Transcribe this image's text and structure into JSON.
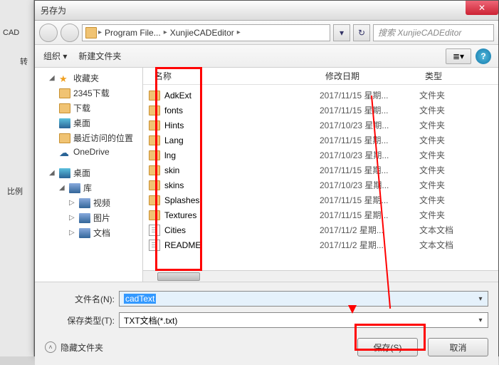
{
  "bg": {
    "cad": "CAD",
    "trans": "转",
    "ratio": "比例"
  },
  "title": "另存为",
  "breadcrumb": {
    "item1": "Program File...",
    "item2": "XunjieCADEditor"
  },
  "search_placeholder": "搜索 XunjieCADEditor",
  "toolbar": {
    "organize": "组织",
    "newfolder": "新建文件夹",
    "view_icon": "≣",
    "help": "?"
  },
  "tree": {
    "fav": "收藏夹",
    "i1": "2345下载",
    "i2": "下载",
    "i3": "桌面",
    "i4": "最近访问的位置",
    "i5": "OneDrive",
    "desktop": "桌面",
    "lib": "库",
    "l1": "视频",
    "l2": "图片",
    "l3": "文档"
  },
  "columns": {
    "name": "名称",
    "date": "修改日期",
    "type": "类型"
  },
  "files": [
    {
      "n": "AdkExt",
      "d": "2017/11/15 星期...",
      "t": "文件夹",
      "k": "folder"
    },
    {
      "n": "fonts",
      "d": "2017/11/15 星期...",
      "t": "文件夹",
      "k": "folder"
    },
    {
      "n": "Hints",
      "d": "2017/10/23 星期...",
      "t": "文件夹",
      "k": "folder"
    },
    {
      "n": "Lang",
      "d": "2017/11/15 星期...",
      "t": "文件夹",
      "k": "folder"
    },
    {
      "n": "lng",
      "d": "2017/10/23 星期...",
      "t": "文件夹",
      "k": "folder"
    },
    {
      "n": "skin",
      "d": "2017/11/15 星期...",
      "t": "文件夹",
      "k": "folder"
    },
    {
      "n": "skins",
      "d": "2017/10/23 星期...",
      "t": "文件夹",
      "k": "folder"
    },
    {
      "n": "Splashes",
      "d": "2017/11/15 星期...",
      "t": "文件夹",
      "k": "folder"
    },
    {
      "n": "Textures",
      "d": "2017/11/15 星期...",
      "t": "文件夹",
      "k": "folder"
    },
    {
      "n": "Cities",
      "d": "2017/11/2 星期...",
      "t": "文本文档",
      "k": "file"
    },
    {
      "n": "README",
      "d": "2017/11/2 星期...",
      "t": "文本文档",
      "k": "file"
    }
  ],
  "fields": {
    "filename_label": "文件名(N):",
    "filename_value": "cadText",
    "filetype_label": "保存类型(T):",
    "filetype_value": "TXT文档(*.txt)"
  },
  "buttons": {
    "hide": "隐藏文件夹",
    "save": "保存(S)",
    "cancel": "取消"
  }
}
